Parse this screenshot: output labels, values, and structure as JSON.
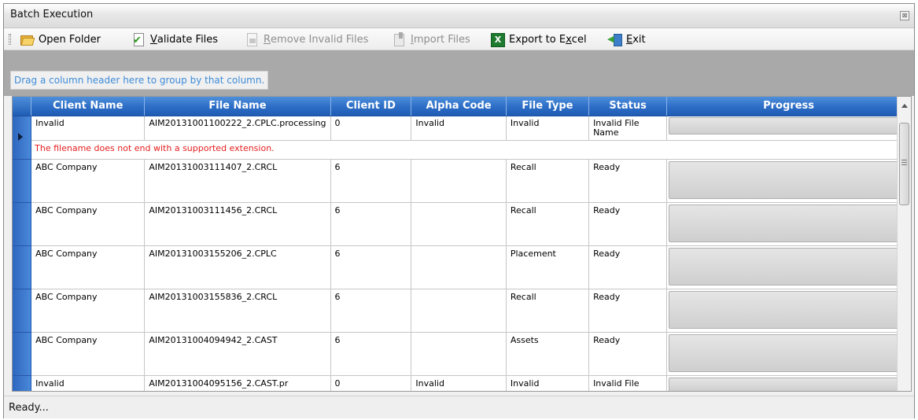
{
  "window": {
    "title": "Batch Execution",
    "close_glyph": "⊠"
  },
  "toolbar": {
    "open_folder": {
      "underline": "",
      "rest": "Open Folder",
      "icon": "folder-icon"
    },
    "validate_files": {
      "underline": "V",
      "rest": "alidate Files",
      "icon": "validate-icon"
    },
    "remove_invalid": {
      "underline": "R",
      "rest": "emove Invalid Files",
      "icon": "remove-icon"
    },
    "import_files": {
      "underline": "I",
      "rest": "mport Files",
      "icon": "import-icon"
    },
    "export_excel": {
      "before": "Export to E",
      "underline": "x",
      "rest": "cel",
      "icon": "excel-icon"
    },
    "exit": {
      "underline": "E",
      "rest": "xit",
      "icon": "exit-icon"
    }
  },
  "group_hint": "Drag a column header here to group by that column.",
  "grid": {
    "columns": [
      "Client Name",
      "File Name",
      "Client ID",
      "Alpha Code",
      "File Type",
      "Status",
      "Progress"
    ],
    "rows": [
      {
        "client_name": "Invalid",
        "file_name": "AIM20131001100222_2.CPLC.processing",
        "client_id": "0",
        "alpha_code": "Invalid",
        "file_type": "Invalid",
        "status": "Invalid File Name",
        "current": true
      },
      {
        "client_name": "ABC Company",
        "file_name": "AIM20131003111407_2.CRCL",
        "client_id": "6",
        "alpha_code": "",
        "file_type": "Recall",
        "status": "Ready"
      },
      {
        "client_name": "ABC Company",
        "file_name": "AIM20131003111456_2.CRCL",
        "client_id": "6",
        "alpha_code": "",
        "file_type": "Recall",
        "status": "Ready"
      },
      {
        "client_name": "ABC Company",
        "file_name": "AIM20131003155206_2.CPLC",
        "client_id": "6",
        "alpha_code": "",
        "file_type": "Placement",
        "status": "Ready"
      },
      {
        "client_name": "ABC Company",
        "file_name": "AIM20131003155836_2.CRCL",
        "client_id": "6",
        "alpha_code": "",
        "file_type": "Recall",
        "status": "Ready"
      },
      {
        "client_name": "ABC Company",
        "file_name": "AIM20131004094942_2.CAST",
        "client_id": "6",
        "alpha_code": "",
        "file_type": "Assets",
        "status": "Ready"
      },
      {
        "client_name": "Invalid",
        "file_name": "AIM20131004095156_2.CAST.pr",
        "client_id": "0",
        "alpha_code": "Invalid",
        "file_type": "Invalid",
        "status": "Invalid File"
      }
    ],
    "error_message": "The filename does not end with a supported extension."
  },
  "status": "Ready..."
}
